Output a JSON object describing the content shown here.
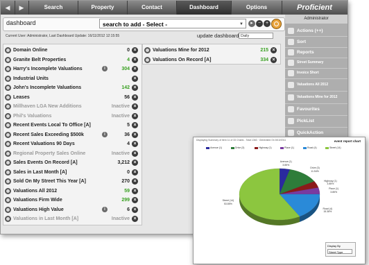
{
  "nav": {
    "back": "◀",
    "forward": "▶",
    "items": [
      "Search",
      "Property",
      "Contact",
      "Dashboard",
      "Options"
    ],
    "brand": "Proficient"
  },
  "toolbar": {
    "title": "dashboard",
    "search_value": "search to add - Select -"
  },
  "info": {
    "user_line": "Current User: Administrator, Last Dashboard Update: 16/11/2012 12:15:55",
    "update_label": "update dashboard",
    "update_select": "Daily"
  },
  "left_items": [
    {
      "label": "Domain Online",
      "value": "0",
      "state": "normal",
      "info": false
    },
    {
      "label": "Granite Belt Properties",
      "value": "4",
      "state": "green",
      "info": false
    },
    {
      "label": "Harry's Incomplete Valuations",
      "value": "304",
      "state": "green",
      "info": true
    },
    {
      "label": "Industrial Units",
      "value": "",
      "state": "normal",
      "info": false
    },
    {
      "label": "John's Incomplete Valuations",
      "value": "142",
      "state": "green",
      "info": false
    },
    {
      "label": "Leases",
      "value": "56",
      "state": "normal",
      "info": false
    },
    {
      "label": "Millhaven LGA New Additions",
      "value": "Inactive",
      "state": "inactive",
      "info": false
    },
    {
      "label": "Phil's Valuations",
      "value": "Inactive",
      "state": "inactive",
      "info": false
    },
    {
      "label": "Recent Events Local To Office [A]",
      "value": "5",
      "state": "normal",
      "info": false
    },
    {
      "label": "Recent Sales Exceeding $500k",
      "value": "36",
      "state": "normal",
      "info": true
    },
    {
      "label": "Recent Valuations 90 Days",
      "value": "4",
      "state": "normal",
      "info": false
    },
    {
      "label": "Regional Property Sales Online",
      "value": "Inactive",
      "state": "inactive",
      "info": false
    },
    {
      "label": "Sales Events On Record [A]",
      "value": "3,212",
      "state": "normal",
      "info": false
    },
    {
      "label": "Sales in Last Month [A]",
      "value": "0",
      "state": "normal",
      "info": false
    },
    {
      "label": "Sold On My Street This Year [A]",
      "value": "270",
      "state": "normal",
      "info": false
    },
    {
      "label": "Valuations All 2012",
      "value": "59",
      "state": "green",
      "info": false
    },
    {
      "label": "Valuations Firm Wide",
      "value": "299",
      "state": "green",
      "info": false
    },
    {
      "label": "Valuations High Value",
      "value": "6",
      "state": "normal",
      "info": true
    },
    {
      "label": "Valuations in Last Month [A]",
      "value": "Inactive",
      "state": "inactive",
      "info": false
    }
  ],
  "middle_items": [
    {
      "label": "Valuations Mine for 2012",
      "value": "215",
      "state": "green"
    },
    {
      "label": "Valuations On Record [A]",
      "value": "334",
      "state": "green"
    }
  ],
  "sidebar": {
    "header": "Administrator",
    "items": [
      "Actions (++)",
      "Sort",
      "Reports",
      "Street Summary",
      "Invoice Short",
      "Valuations All 2012",
      "Valuations Mine for 2012",
      "Favourites",
      "PickList",
      "QuickAction"
    ]
  },
  "chart_window": {
    "header_text": "Displaying Summary of Item 11 of 33 Charts - Total 1363 · Generated On 8/10/2011",
    "title": "event report chart",
    "display_by_label": "Display By",
    "display_by_value": "Street Type"
  },
  "chart_data": {
    "type": "pie",
    "title": "event report chart",
    "legend_position": "top",
    "series": [
      {
        "name": "Avenue (1)",
        "label": "Avenue (1)",
        "percent_text": "3.85%",
        "value": 3.85,
        "color": "#2a2a9e"
      },
      {
        "name": "Drive (3)",
        "label": "Drive (3)",
        "percent_text": "11.54%",
        "value": 11.54,
        "color": "#2e7d3a"
      },
      {
        "name": "Highway (1)",
        "label": "Highway (1)",
        "percent_text": "3.85%",
        "value": 3.85,
        "color": "#8b1a1a"
      },
      {
        "name": "Place (1)",
        "label": "Place (1)",
        "percent_text": "3.85%",
        "value": 3.85,
        "color": "#7a3aa0"
      },
      {
        "name": "Road (4)",
        "label": "Road (4)",
        "percent_text": "15.38%",
        "value": 15.38,
        "color": "#2a8ad8"
      },
      {
        "name": "Street (14)",
        "label": "Street (14)",
        "percent_text": "53.85%",
        "value": 53.85,
        "color": "#8cc63f"
      }
    ]
  }
}
